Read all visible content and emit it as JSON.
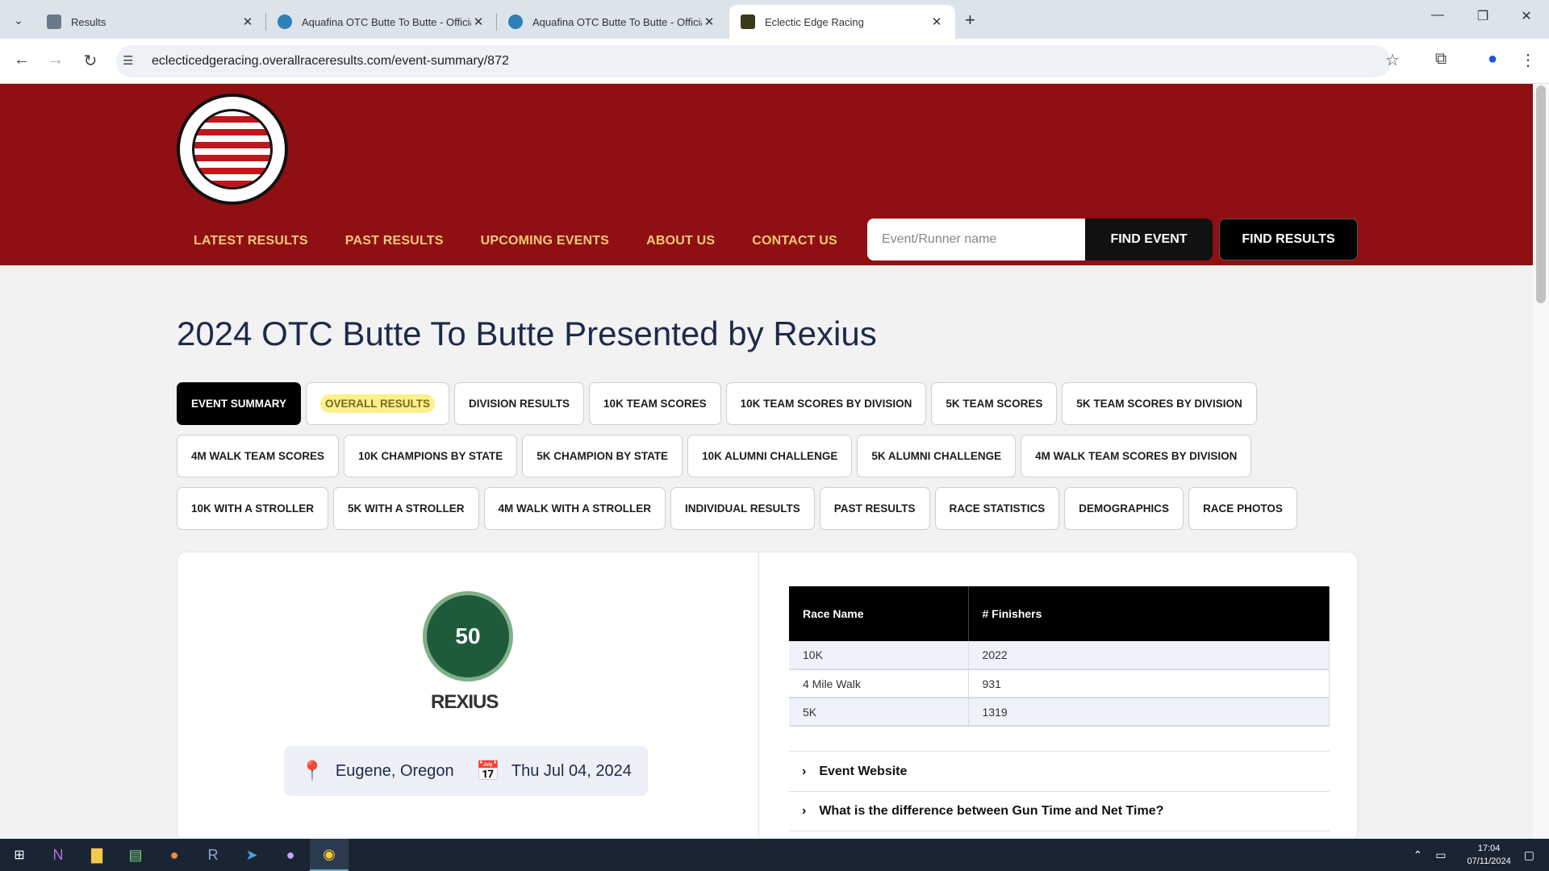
{
  "browser": {
    "tabs": [
      {
        "label": "Results",
        "active": false
      },
      {
        "label": "Aquafina OTC Butte To Butte - Official",
        "active": false
      },
      {
        "label": "Aquafina OTC Butte To Butte - Official",
        "active": false
      },
      {
        "label": "Eclectic Edge Racing",
        "active": true
      }
    ],
    "new_tab_icon": "plus-icon",
    "url": "eclecticedgeracing.overallraceresults.com/event-summary/872"
  },
  "site": {
    "logo_text": "ECLECTIC EDGE RACING",
    "nav": [
      "LATEST RESULTS",
      "PAST RESULTS",
      "UPCOMING EVENTS",
      "ABOUT US",
      "CONTACT US"
    ],
    "search_placeholder": "Event/Runner name",
    "find_event": "FIND EVENT",
    "find_results": "FIND RESULTS"
  },
  "event": {
    "title": "2024 OTC Butte To Butte Presented by Rexius",
    "tabs_row1": [
      "EVENT SUMMARY",
      "OVERALL RESULTS",
      "DIVISION RESULTS",
      "10K TEAM SCORES",
      "10K TEAM SCORES BY DIVISION",
      "5K TEAM SCORES",
      "5K TEAM SCORES BY DIVISION"
    ],
    "tabs_row2": [
      "4M WALK TEAM SCORES",
      "10K CHAMPIONS BY STATE",
      "5K CHAMPION BY STATE",
      "10K ALUMNI CHALLENGE",
      "5K ALUMNI CHALLENGE",
      "4M WALK TEAM SCORES BY DIVISION"
    ],
    "tabs_row3": [
      "10K WITH A STROLLER",
      "5K WITH A STROLLER",
      "4M WALK WITH A STROLLER",
      "INDIVIDUAL RESULTS",
      "PAST RESULTS",
      "RACE STATISTICS",
      "DEMOGRAPHICS",
      "RACE PHOTOS"
    ],
    "logo_text": "50",
    "sponsor": "REXIUS",
    "location": "Eugene, Oregon",
    "date": "Thu Jul 04, 2024",
    "table": {
      "headers": [
        "Race Name",
        "# Finishers"
      ],
      "rows": [
        [
          "10K",
          "2022"
        ],
        [
          "4 Mile Walk",
          "931"
        ],
        [
          "5K",
          "1319"
        ]
      ]
    },
    "accordions": [
      "Event Website",
      "What is the difference between Gun Time and Net Time?"
    ]
  },
  "taskbar": {
    "time": "17:04",
    "date": "07/11/2024"
  }
}
